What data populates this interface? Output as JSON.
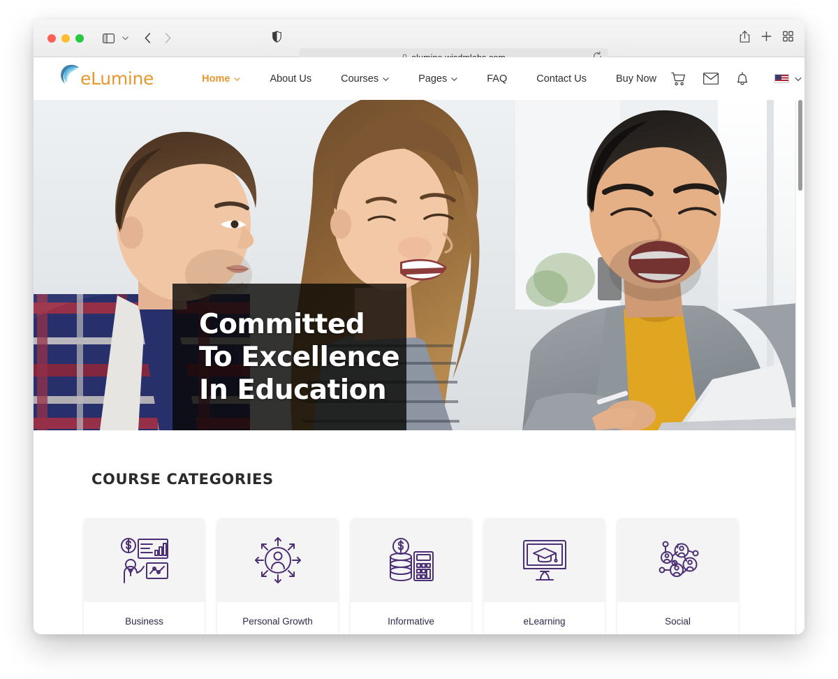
{
  "browser": {
    "name": "safari",
    "url": "elumine.wisdmlabs.com",
    "lock_icon": "lock-icon",
    "reload_icon": "reload-icon",
    "back_icon": "chevron-left-icon",
    "forward_icon": "chevron-right-icon",
    "sidebar_icon": "sidebar-toggle-icon",
    "shield_icon": "privacy-shield-icon",
    "share_icon": "share-icon",
    "newtab_icon": "plus-icon",
    "tabs_overview_icon": "grid-icon",
    "traffic_lights": [
      "close-red",
      "minimize-yellow",
      "maximize-green"
    ]
  },
  "site": {
    "logo": {
      "text": "eLumine",
      "mark": "swirl-circle-logo-mark",
      "color": "#e8972e"
    },
    "nav": [
      {
        "label": "Home",
        "has_dropdown": true,
        "active": true
      },
      {
        "label": "About Us",
        "has_dropdown": false,
        "active": false
      },
      {
        "label": "Courses",
        "has_dropdown": true,
        "active": false
      },
      {
        "label": "Pages",
        "has_dropdown": true,
        "active": false
      },
      {
        "label": "FAQ",
        "has_dropdown": false,
        "active": false
      },
      {
        "label": "Contact Us",
        "has_dropdown": false,
        "active": false
      },
      {
        "label": "Buy Now",
        "has_dropdown": false,
        "active": false
      }
    ],
    "nav_icons": [
      {
        "name": "cart-icon"
      },
      {
        "name": "mail-icon"
      },
      {
        "name": "bell-icon"
      }
    ],
    "language": {
      "flag": "us-flag-icon",
      "chevron": "chevron-down-icon"
    },
    "hero": {
      "title_line1": "Committed",
      "title_line2": "To Excellence",
      "title_line3": "In Education",
      "alt": "three-students-smiling-at-laptop"
    },
    "categories_section": {
      "heading": "COURSE CATEGORIES",
      "cards": [
        {
          "label": "Business",
          "icon": "business-presentation-icon"
        },
        {
          "label": "Personal Growth",
          "icon": "personal-growth-icon"
        },
        {
          "label": "Informative",
          "icon": "coins-calculator-icon"
        },
        {
          "label": "eLearning",
          "icon": "monitor-graduation-cap-icon"
        },
        {
          "label": "Social",
          "icon": "social-network-people-icon"
        }
      ]
    }
  },
  "colors": {
    "accent_orange": "#e8972e",
    "icon_purple": "#4b2e73",
    "card_gray": "#f4f4f5",
    "text_dark": "#2b2b2b"
  }
}
